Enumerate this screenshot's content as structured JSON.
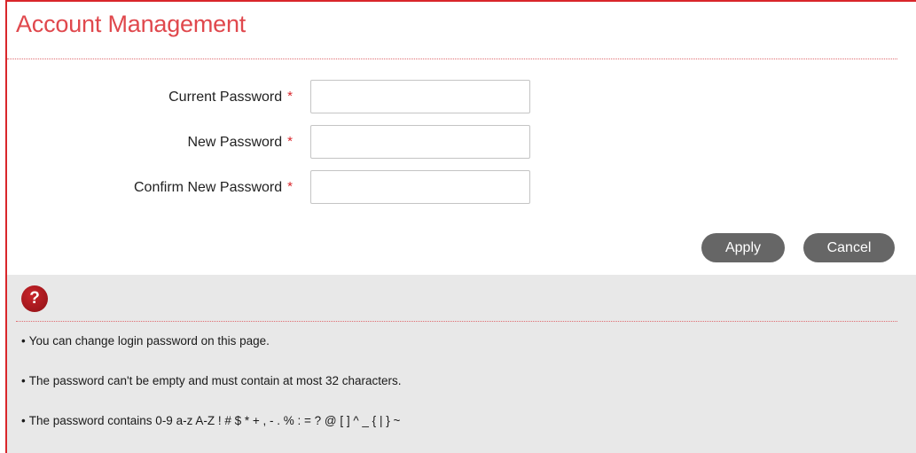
{
  "page": {
    "title": "Account Management"
  },
  "form": {
    "required_marker": "*",
    "fields": [
      {
        "label": "Current Password",
        "value": "",
        "placeholder": ""
      },
      {
        "label": "New Password",
        "value": "",
        "placeholder": ""
      },
      {
        "label": "Confirm New Password",
        "value": "",
        "placeholder": ""
      }
    ]
  },
  "actions": {
    "apply_label": "Apply",
    "cancel_label": "Cancel"
  },
  "help": {
    "icon": "question-mark-icon",
    "icon_glyph": "?",
    "bullet": "•",
    "items": [
      "You can change login password on this page.",
      "The password can't be empty and must contain at most 32 characters.",
      "The password contains 0-9 a-z A-Z ! # $ * + , - . % : = ? @ [ ] ^ _ { | } ~"
    ]
  },
  "colors": {
    "accent": "#d9262b",
    "title": "#e0484d",
    "button": "#666666",
    "help_background": "#e8e8e8"
  }
}
